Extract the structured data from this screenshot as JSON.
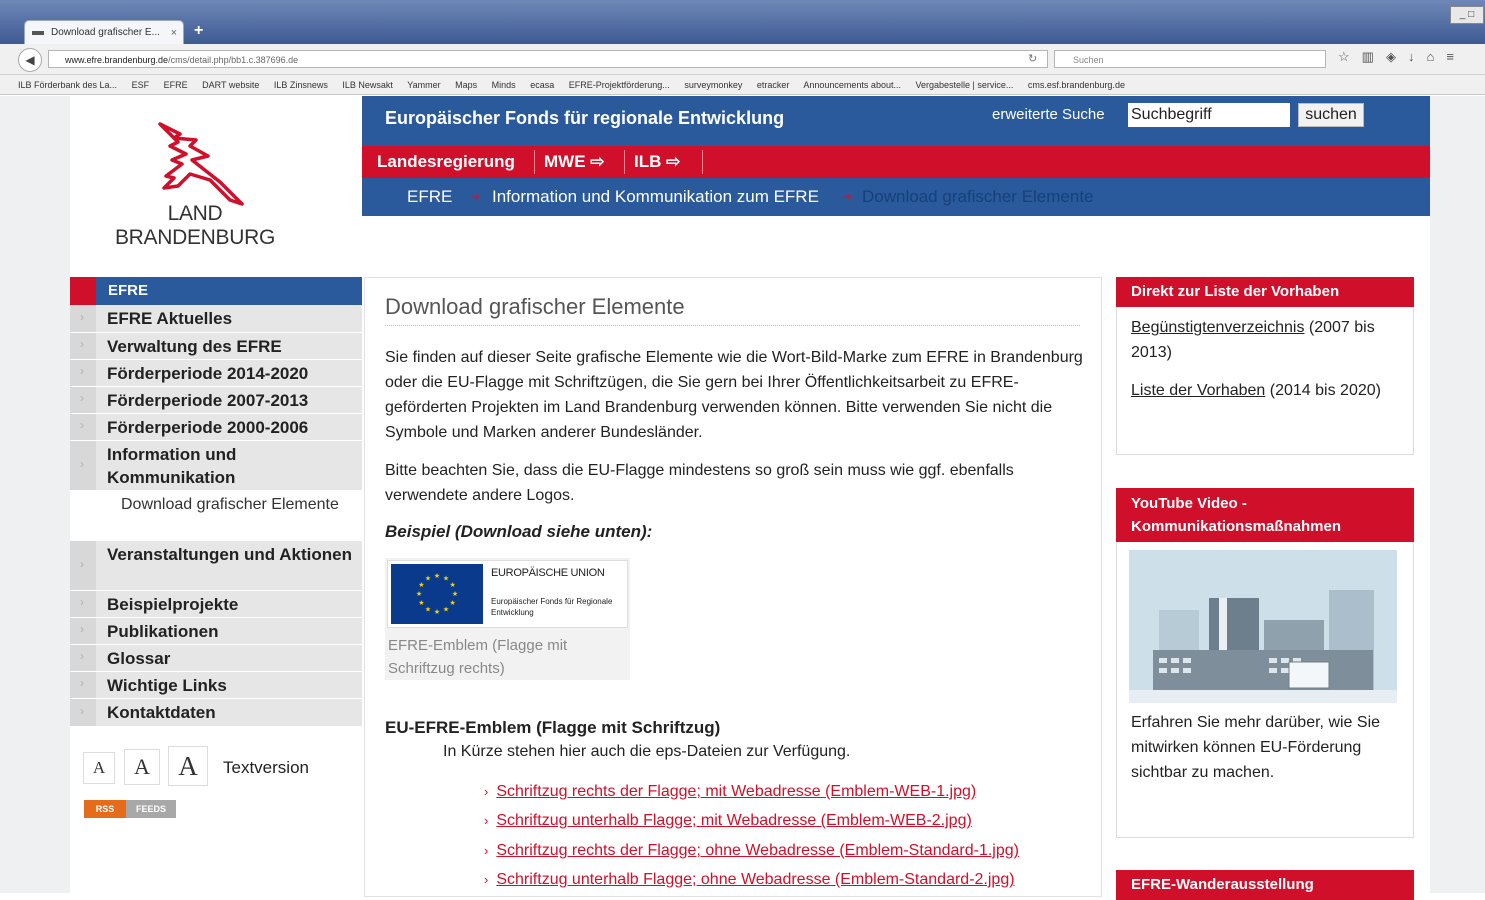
{
  "browser": {
    "tab_title": "Download grafischer E...",
    "tab_close": "×",
    "new_tab": "+",
    "window_controls": "_ □",
    "url_domain": "www.efre.brandenburg.de",
    "url_path": "/cms/detail.php/bb1.c.387696.de",
    "search_placeholder": "Suchen",
    "bookmarks": [
      "ILB Förderbank des La...",
      "ESF",
      "EFRE",
      "DART website",
      "ILB Zinsnews",
      "ILB Newsakt",
      "Yammer",
      "Maps",
      "Minds",
      "ecasa",
      "EFRE-Projektförderung...",
      "surveymonkey",
      "etracker",
      "Announcements about...",
      "Vergabestelle | service...",
      "cms.esf.brandenburg.de"
    ]
  },
  "logo": {
    "line1": "LAND",
    "line2": "BRANDENBURG"
  },
  "header": {
    "title": "Europäischer Fonds für regionale Entwicklung",
    "advanced_search": "erweiterte Suche",
    "search_value": "Suchbegriff",
    "search_button": "suchen",
    "red_nav": [
      "Landesregierung",
      "MWE ⇨",
      "ILB ⇨"
    ],
    "breadcrumb": [
      "EFRE",
      "Information und Kommunikation zum EFRE",
      "Download grafischer Elemente"
    ]
  },
  "left_nav": {
    "head": "EFRE",
    "items": [
      {
        "label": "EFRE Aktuelles"
      },
      {
        "label": "Verwaltung des EFRE"
      },
      {
        "label": "Förderperiode 2014-2020"
      },
      {
        "label": "Förderperiode 2007-2013"
      },
      {
        "label": "Förderperiode 2000-2006"
      },
      {
        "label": "Information und Kommunikation"
      },
      {
        "label": "Veranstaltungen und Aktionen"
      },
      {
        "label": "Beispielprojekte"
      },
      {
        "label": "Publikationen"
      },
      {
        "label": "Glossar"
      },
      {
        "label": "Wichtige Links"
      },
      {
        "label": "Kontaktdaten"
      }
    ],
    "active_sub": "Download grafischer Elemente",
    "font_small": "A",
    "font_medium": "A",
    "font_large": "A",
    "text_version": "Textversion",
    "rss": "RSS",
    "feeds": "FEEDS"
  },
  "main": {
    "title": "Download grafischer Elemente",
    "para1": "Sie finden auf dieser Seite grafische Elemente wie die Wort-Bild-Marke zum EFRE in Brandenburg oder die EU-Flagge mit Schriftzügen, die Sie gern bei Ihrer Öffentlichkeitsarbeit zu EFRE-geförderten Projekten im Land Brandenburg verwenden können. Bitte verwenden Sie nicht die Symbole und Marken anderer Bundesländer.",
    "para2": "Bitte beachten Sie, dass die EU-Flagge mindestens so groß sein muss wie ggf. ebenfalls verwendete andere Logos.",
    "example_label": "Beispiel (Download siehe unten):",
    "emblem_union": "EUROPÄISCHE UNION",
    "emblem_fund": "Europäischer Fonds für Regionale Entwicklung",
    "emblem_caption": "EFRE-Emblem (Flagge mit Schriftzug rechts)",
    "emblem_heading": "EU-EFRE-Emblem (Flagge mit Schriftzug)",
    "emblem_sub": "In Kürze stehen hier auch die eps-Dateien zur Verfügung.",
    "downloads": [
      "Schriftzug rechts der Flagge; mit Webadresse (Emblem-WEB-1.jpg)",
      "Schriftzug unterhalb Flagge; mit Webadresse (Emblem-WEB-2.jpg)",
      "Schriftzug rechts der Flagge; ohne Webadresse (Emblem-Standard-1.jpg)",
      "Schriftzug unterhalb Flagge; ohne Webadresse (Emblem-Standard-2.jpg)"
    ]
  },
  "right": {
    "box1_head": "Direkt zur Liste der Vorhaben",
    "box1_link1": "Begünstigtenverzeichnis",
    "box1_link1_rest": " (2007 bis 2013)",
    "box1_link2": "Liste der Vorhaben",
    "box1_link2_rest": " (2014 bis 2020)",
    "box2_head": "YouTube Video - Kommunikationsmaßnahmen",
    "box2_text": "Erfahren Sie mehr darüber, wie Sie mitwirken können EU-Förderung sichtbar zu machen.",
    "box3_head": "EFRE-Wanderausstellung"
  },
  "colors": {
    "brand_blue": "#2a5a9c",
    "brand_red": "#d0102a"
  }
}
